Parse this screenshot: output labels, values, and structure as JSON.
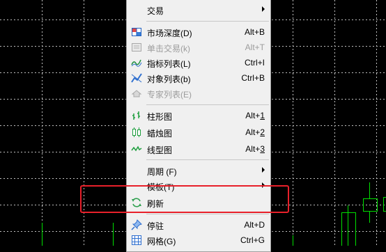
{
  "menu": {
    "items": [
      {
        "label": "交易",
        "submenu": true
      },
      {
        "label": "市场深度(D)",
        "shortcut": "Alt+B",
        "icon": "market-depth-icon"
      },
      {
        "label": "单击交易(k)",
        "shortcut": "Alt+T",
        "icon": "one-click-trading-icon",
        "disabled": true
      },
      {
        "label": "指标列表(L)",
        "shortcut": "Ctrl+I",
        "icon": "indicator-list-icon"
      },
      {
        "label": "对象列表(b)",
        "shortcut": "Ctrl+B",
        "icon": "object-list-icon"
      },
      {
        "label": "专家列表(E)",
        "icon": "expert-list-icon",
        "disabled": true
      },
      {
        "label": "柱形图",
        "shortcut_prefix": "Alt+",
        "shortcut_key": "1",
        "icon": "bar-chart-icon"
      },
      {
        "label": "蜡烛图",
        "shortcut_prefix": "Alt+",
        "shortcut_key": "2",
        "icon": "candlestick-icon"
      },
      {
        "label": "线型图",
        "shortcut_prefix": "Alt+",
        "shortcut_key": "3",
        "icon": "line-chart-icon"
      },
      {
        "label": "周期 (F)",
        "submenu": true
      },
      {
        "label": "模板(T)",
        "submenu": true
      },
      {
        "label": "刷新",
        "icon": "refresh-icon"
      },
      {
        "label": "停驻",
        "shortcut": "Alt+D",
        "icon": "pin-icon"
      },
      {
        "label": "网格(G)",
        "shortcut": "Ctrl+G",
        "icon": "grid-icon"
      }
    ]
  },
  "colors": {
    "chart_background": "#000000",
    "grid": "#c0c0c0",
    "candle_green": "#00e000",
    "highlight_box": "#e8202a",
    "menu_background": "#f0f0f0"
  }
}
